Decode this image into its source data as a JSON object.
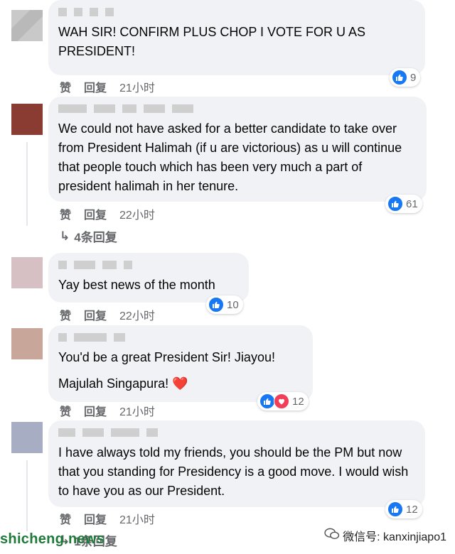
{
  "comments": [
    {
      "text": [
        "WAH SIR! CONFIRM PLUS CHOP I VOTE FOR U AS PRESIDENT!"
      ],
      "reaction_count": "9",
      "reaction_types": [
        "like"
      ],
      "like_label": "赞",
      "reply_label": "回复",
      "time": "21小时"
    },
    {
      "text": [
        "We could not have asked for a better candidate to take over from President Halimah (if u are victorious) as u will continue that people touch which has been very much a part of president halimah in her tenure."
      ],
      "reaction_count": "61",
      "reaction_types": [
        "like"
      ],
      "like_label": "赞",
      "reply_label": "回复",
      "time": "22小时",
      "replies_label": "4条回复"
    },
    {
      "text": [
        "Yay best news of the month"
      ],
      "reaction_count": "10",
      "reaction_types": [
        "like"
      ],
      "like_label": "赞",
      "reply_label": "回复",
      "time": "22小时"
    },
    {
      "text": [
        "You'd be a great President Sir! Jiayou!",
        "Majulah Singapura! ❤️"
      ],
      "reaction_count": "12",
      "reaction_types": [
        "like",
        "love"
      ],
      "like_label": "赞",
      "reply_label": "回复",
      "time": "21小时"
    },
    {
      "text": [
        "I have always told my friends, you should be the PM but now that you standing for Presidency is a good move. I would wish to have you as our President."
      ],
      "reaction_count": "12",
      "reaction_types": [
        "like"
      ],
      "like_label": "赞",
      "reply_label": "回复",
      "time": "21小时",
      "replies_label": "1条回复"
    }
  ],
  "watermark": {
    "left": "shicheng.news",
    "right": "微信号: kanxinjiapo1"
  },
  "colors": {
    "bubble": "#f0f2f5",
    "like_blue": "#1877f2",
    "love_red": "#f33e58",
    "meta_gray": "#65676b"
  }
}
